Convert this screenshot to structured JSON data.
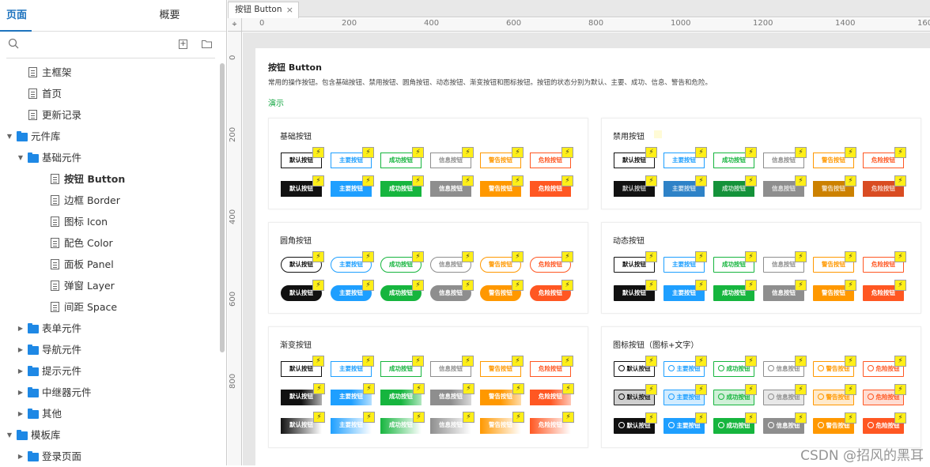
{
  "sidebar": {
    "tabs": [
      {
        "label": "页面"
      },
      {
        "label": "概要"
      }
    ],
    "tree": [
      {
        "label": "主框架",
        "type": "page",
        "level": 1
      },
      {
        "label": "首页",
        "type": "page",
        "level": 1
      },
      {
        "label": "更新记录",
        "type": "page",
        "level": 1
      },
      {
        "label": "元件库",
        "type": "folder",
        "level": 0,
        "expanded": true
      },
      {
        "label": "基础元件",
        "type": "folder",
        "level": 1,
        "expanded": true
      },
      {
        "label": "按钮 Button",
        "type": "page",
        "level": 2,
        "selected": true
      },
      {
        "label": "边框 Border",
        "type": "page",
        "level": 2
      },
      {
        "label": "图标 Icon",
        "type": "page",
        "level": 2
      },
      {
        "label": "配色 Color",
        "type": "page",
        "level": 2
      },
      {
        "label": "面板 Panel",
        "type": "page",
        "level": 2
      },
      {
        "label": "弹窗 Layer",
        "type": "page",
        "level": 2
      },
      {
        "label": "间距 Space",
        "type": "page",
        "level": 2
      },
      {
        "label": "表单元件",
        "type": "folder",
        "level": 1,
        "expanded": false
      },
      {
        "label": "导航元件",
        "type": "folder",
        "level": 1,
        "expanded": false
      },
      {
        "label": "提示元件",
        "type": "folder",
        "level": 1,
        "expanded": false
      },
      {
        "label": "中继器元件",
        "type": "folder",
        "level": 1,
        "expanded": false
      },
      {
        "label": "其他",
        "type": "folder",
        "level": 1,
        "expanded": false
      },
      {
        "label": "模板库",
        "type": "folder",
        "level": 0,
        "expanded": true
      },
      {
        "label": "登录页面",
        "type": "folder",
        "level": 1,
        "expanded": false
      }
    ]
  },
  "tab": {
    "label": "按钮 Button",
    "close": "×"
  },
  "ruler": {
    "corner": "⌖",
    "top_ticks": [
      "0",
      "200",
      "400",
      "600",
      "800",
      "1000",
      "1200",
      "1400",
      "160"
    ],
    "left_ticks": [
      "0",
      "200",
      "400",
      "600",
      "800"
    ]
  },
  "page": {
    "title": "按钮 Button",
    "description": "常用的操作按钮。包含基础按钮、禁用按钮、圆角按钮、动态按钮、渐变按钮和图标按钮。按钮的状态分别为默认、主要、成功、信息、警告和危险。",
    "demo_label": "演示"
  },
  "button_labels": [
    "默认按钮",
    "主要按钮",
    "成功按钮",
    "信息按钮",
    "警告按钮",
    "危险按钮"
  ],
  "bolt": "⚡",
  "colors": {
    "default": "#111111",
    "primary": "#1e9fff",
    "success": "#16b53e",
    "info": "#8e8e8e",
    "warning": "#ff9800",
    "danger": "#ff5722",
    "disabled_primary": "#2e82c7",
    "disabled_success": "#14923a",
    "disabled_warning": "#cc8100",
    "disabled_danger": "#d94c22"
  },
  "cards": [
    {
      "title": "基础按钮",
      "style": "basic"
    },
    {
      "title": "禁用按钮",
      "style": "disabled"
    },
    {
      "title": "圆角按钮",
      "style": "round"
    },
    {
      "title": "动态按钮",
      "style": "dynamic"
    },
    {
      "title": "渐变按钮",
      "style": "gradient"
    },
    {
      "title": "图标按钮（图标+文字）",
      "style": "icon"
    }
  ],
  "watermark": "CSDN @招风的黑耳"
}
